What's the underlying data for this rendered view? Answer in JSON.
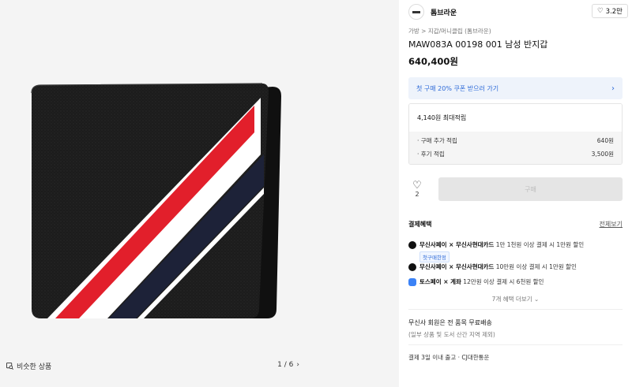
{
  "gallery": {
    "similar_label": "비슷한 상품",
    "pager": "1 / 6"
  },
  "brand": {
    "name": "톰브라운",
    "likes": "3.2만"
  },
  "product": {
    "breadcrumb": "가방 > 지갑/머니클립 (톰브라운)",
    "title": "MAW083A 00198 001 남성 반지갑",
    "price": "640,400원"
  },
  "coupon": {
    "text": "첫 구매 20% 쿠폰 받으러 가기"
  },
  "points": {
    "max": "4,140원 최대적립",
    "lines": [
      {
        "label": "· 구매 추가 적립",
        "value": "640원"
      },
      {
        "label": "· 후기 적립",
        "value": "3,500원"
      }
    ]
  },
  "actions": {
    "like_count": "2",
    "buy_label": "구매"
  },
  "benefits": {
    "title": "결제혜택",
    "view_all": "전체보기",
    "items": [
      {
        "brand": "무신사페이 × 무신사현대카드",
        "desc": "1만 1천원 이상 결제 시 1만원 할인",
        "tag": "첫구매한정"
      },
      {
        "brand": "무신사페이 × 무신사현대카드",
        "desc": "10만원 이상 결제 시 1만원 할인"
      },
      {
        "brand": "토스페이 × 계좌",
        "desc": "12만원 이상 결제 시 6천원 할인"
      }
    ],
    "more": "7개 혜택 더보기"
  },
  "shipping": {
    "title": "무신사 회원은 전 품목 무료배송",
    "sub": "(일부 상품 및 도서 산간 지역 제외)",
    "delivery": "결제 3일 이내 출고 · CJ대한통운"
  },
  "colors": {
    "accent_blue": "#2f6bd8",
    "stripe_red": "#e21f2b",
    "stripe_white": "#ffffff",
    "stripe_navy": "#1d2238",
    "wallet_body": "#1a1a1a"
  }
}
